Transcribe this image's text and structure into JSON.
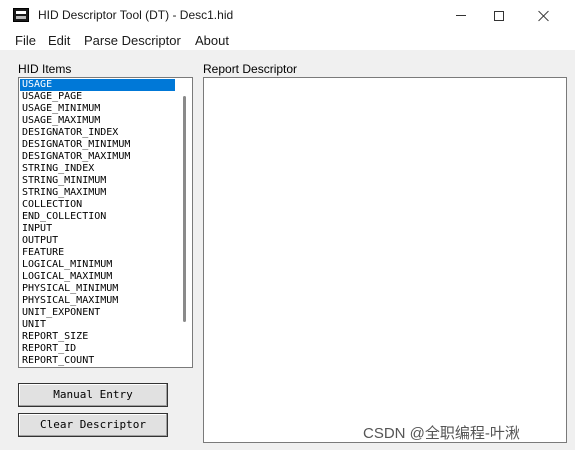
{
  "window": {
    "title": "HID Descriptor Tool (DT) - Desc1.hid"
  },
  "menu": [
    {
      "label": "File"
    },
    {
      "label": "Edit"
    },
    {
      "label": "Parse Descriptor"
    },
    {
      "label": "About"
    }
  ],
  "hid_items": {
    "label": "HID Items",
    "selected": "USAGE",
    "items": [
      "USAGE",
      "USAGE_PAGE",
      "USAGE_MINIMUM",
      "USAGE_MAXIMUM",
      "DESIGNATOR_INDEX",
      "DESIGNATOR_MINIMUM",
      "DESIGNATOR_MAXIMUM",
      "STRING_INDEX",
      "STRING_MINIMUM",
      "STRING_MAXIMUM",
      "COLLECTION",
      "END_COLLECTION",
      "INPUT",
      "OUTPUT",
      "FEATURE",
      "LOGICAL_MINIMUM",
      "LOGICAL_MAXIMUM",
      "PHYSICAL_MINIMUM",
      "PHYSICAL_MAXIMUM",
      "UNIT_EXPONENT",
      "UNIT",
      "REPORT_SIZE",
      "REPORT_ID",
      "REPORT_COUNT"
    ]
  },
  "buttons": {
    "manual_entry": "Manual Entry",
    "clear_descriptor": "Clear Descriptor"
  },
  "report_descriptor": {
    "label": "Report Descriptor",
    "content": ""
  },
  "watermark": "CSDN @全职编程-叶湫",
  "colors": {
    "selection": "#0078d7",
    "window_bg": "#f0f0f0"
  },
  "icons": {
    "app": "hid-tool-app-icon",
    "minimize": "minimize-icon",
    "maximize": "maximize-icon",
    "close": "close-icon"
  }
}
